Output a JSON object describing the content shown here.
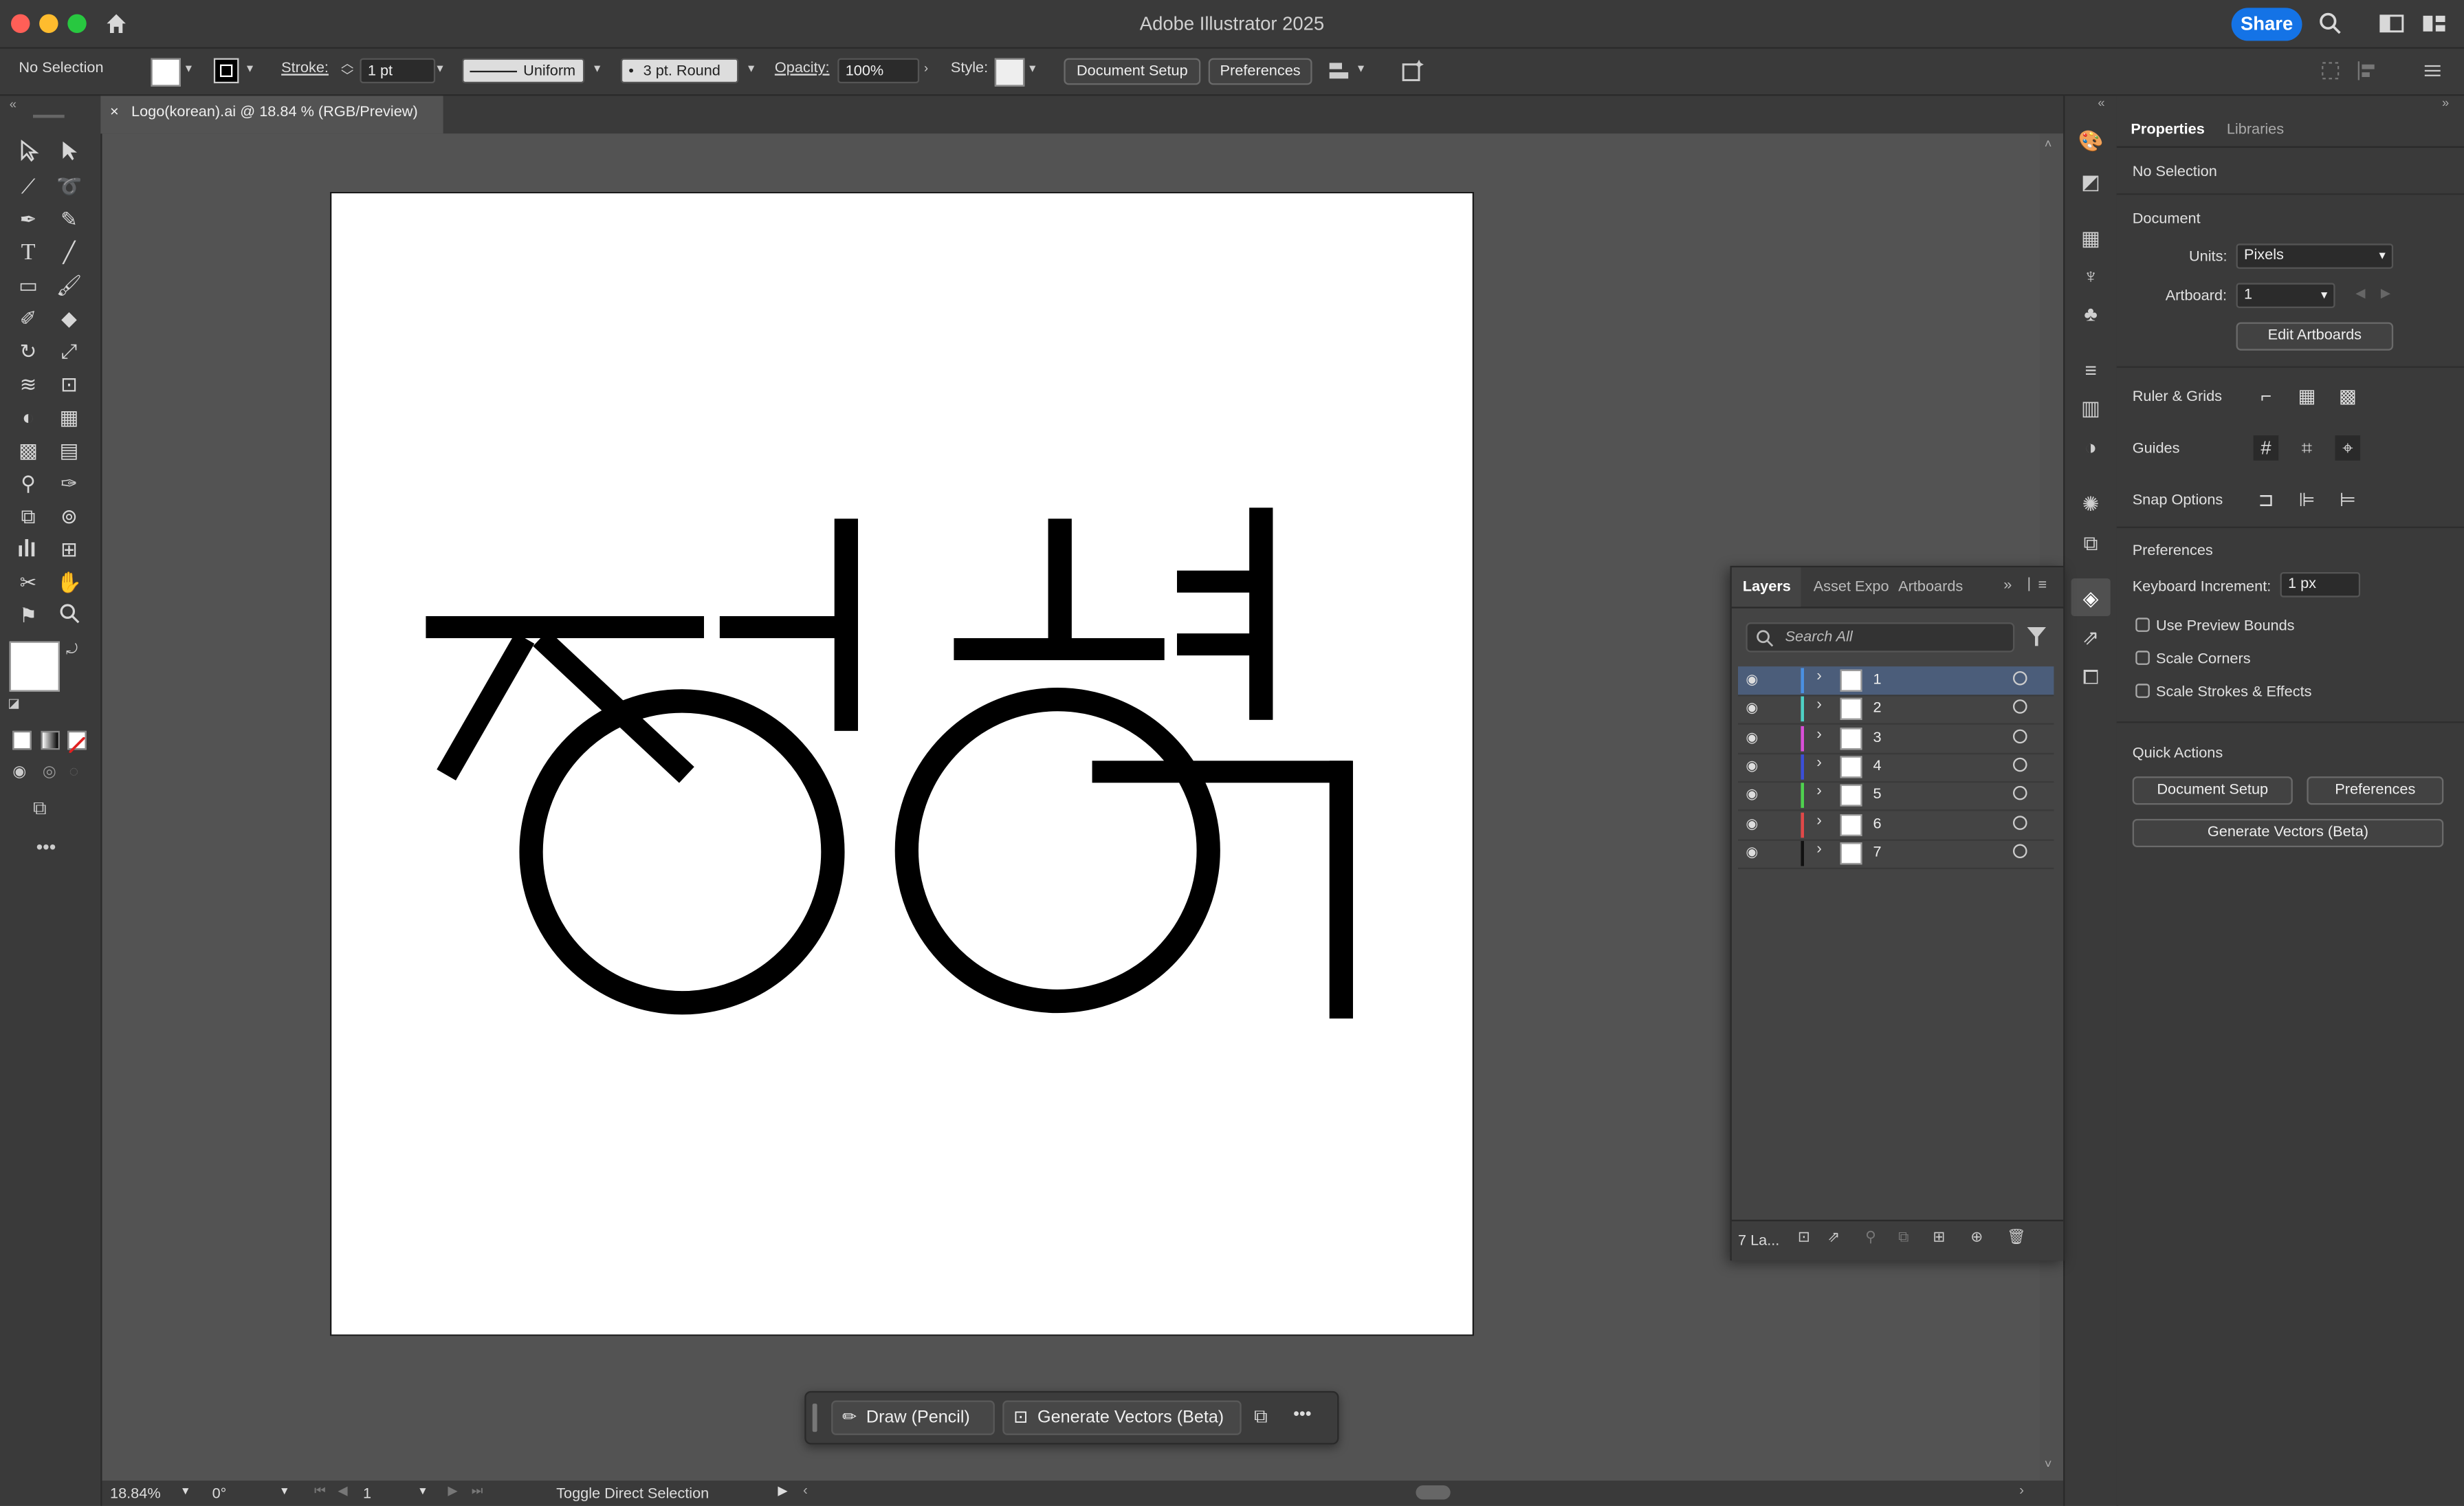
{
  "app": {
    "title": "Adobe Illustrator 2025",
    "share_label": "Share"
  },
  "control_bar": {
    "selection_label": "No Selection",
    "stroke_label": "Stroke:",
    "stroke_weight": "1 pt",
    "stroke_profile": "Uniform",
    "brush": "3 pt. Round",
    "opacity_label": "Opacity:",
    "opacity_value": "100%",
    "style_label": "Style:",
    "document_setup": "Document Setup",
    "preferences": "Preferences"
  },
  "document_tab": {
    "close": "×",
    "title": "Logo(korean).ai @ 18.84 % (RGB/Preview)"
  },
  "status_bar": {
    "zoom": "18.84%",
    "rotation": "0°",
    "artboard_number": "1",
    "status_text": "Toggle Direct Selection"
  },
  "task_bar": {
    "draw_label": "Draw (Pencil)",
    "generate_label": "Generate Vectors (Beta)",
    "more": "•••"
  },
  "properties_panel": {
    "tab_properties": "Properties",
    "tab_libraries": "Libraries",
    "selection": "No Selection",
    "document_heading": "Document",
    "units_label": "Units:",
    "units_value": "Pixels",
    "artboard_label": "Artboard:",
    "artboard_value": "1",
    "edit_artboards": "Edit Artboards",
    "ruler_grids": "Ruler & Grids",
    "guides": "Guides",
    "snap_options": "Snap Options",
    "preferences_heading": "Preferences",
    "keyboard_increment_label": "Keyboard Increment:",
    "keyboard_increment_value": "1 px",
    "use_preview_bounds": "Use Preview Bounds",
    "scale_corners": "Scale Corners",
    "scale_strokes": "Scale Strokes & Effects",
    "quick_actions": "Quick Actions",
    "qa_document_setup": "Document Setup",
    "qa_preferences": "Preferences",
    "qa_generate_vectors": "Generate Vectors (Beta)"
  },
  "layers_panel": {
    "tab_layers": "Layers",
    "tab_asset_export": "Asset Expo",
    "tab_artboards": "Artboards",
    "search_placeholder": "Search All",
    "footer_count": "7 La...",
    "layers": [
      {
        "name": "1",
        "color": "#4a90e2"
      },
      {
        "name": "2",
        "color": "#4fd1c5"
      },
      {
        "name": "3",
        "color": "#d94fd8"
      },
      {
        "name": "4",
        "color": "#3b4fd8"
      },
      {
        "name": "5",
        "color": "#4fd14f"
      },
      {
        "name": "6",
        "color": "#e04848"
      },
      {
        "name": "7",
        "color": "#111111"
      }
    ]
  },
  "colors": {
    "accent": "#1473e6",
    "ui_dark": "#3a3a3a",
    "canvas_bg": "#535353",
    "artboard": "#ffffff",
    "artwork": "#000000"
  }
}
